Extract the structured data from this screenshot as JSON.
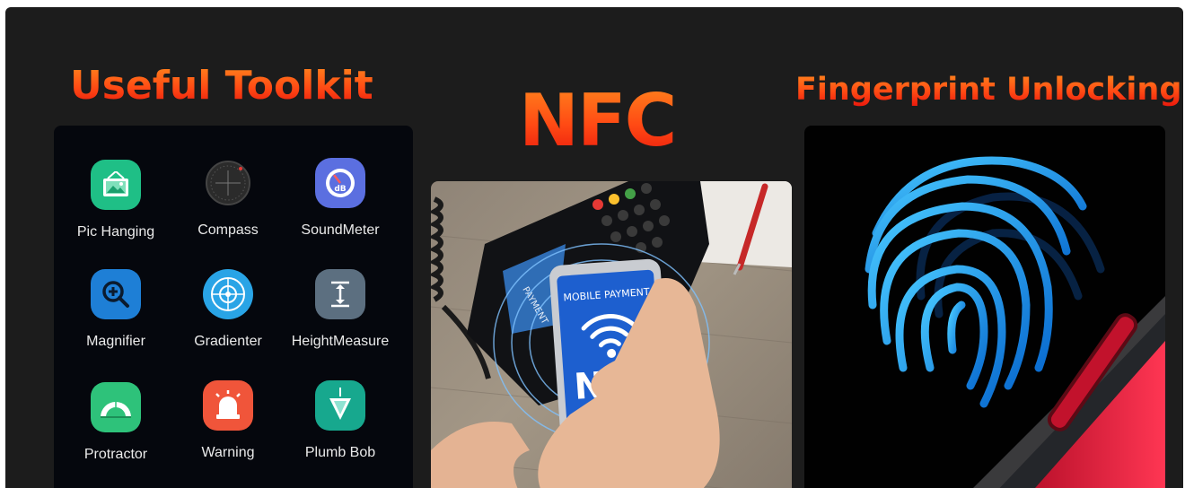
{
  "headlines": {
    "toolkit": "Useful Toolkit",
    "nfc": "NFC",
    "fingerprint": "Fingerprint Unlocking"
  },
  "tools": [
    {
      "label": "Pic Hanging",
      "icon": "picture-icon",
      "color": "#1fbf86"
    },
    {
      "label": "Compass",
      "icon": "compass-icon",
      "color": "#2a2a2a"
    },
    {
      "label": "SoundMeter",
      "icon": "sound-meter-icon",
      "color": "#5b6fe0"
    },
    {
      "label": "Magnifier",
      "icon": "magnifier-icon",
      "color": "#1e7fd6"
    },
    {
      "label": "Gradienter",
      "icon": "gradienter-icon",
      "color": "#29a4e6"
    },
    {
      "label": "HeightMeasure",
      "icon": "height-measure-icon",
      "color": "#5c6f80"
    },
    {
      "label": "Protractor",
      "icon": "protractor-icon",
      "color": "#2ec27a"
    },
    {
      "label": "Warning",
      "icon": "warning-icon",
      "color": "#f0553a"
    },
    {
      "label": "Plumb Bob",
      "icon": "plumb-bob-icon",
      "color": "#17a88e"
    }
  ],
  "nfc_photo": {
    "screen_title": "MOBILE PAYMENT",
    "screen_label": "NFC",
    "terminal_text": "PAYMENT\nPTED"
  }
}
